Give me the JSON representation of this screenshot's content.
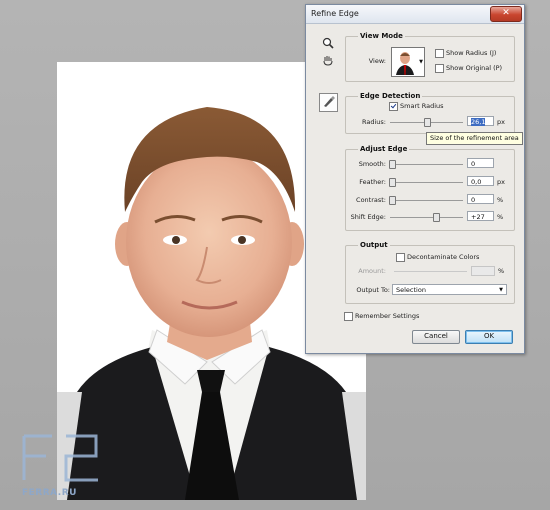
{
  "watermark": {
    "text": "FERRA.RU"
  },
  "dialog": {
    "title": "Refine Edge",
    "close_glyph": "✕",
    "view_mode": {
      "heading": "View Mode",
      "view_label": "View:",
      "show_radius": {
        "label": "Show Radius (J)",
        "checked": false
      },
      "show_original": {
        "label": "Show Original (P)",
        "checked": false
      }
    },
    "edge_detection": {
      "heading": "Edge Detection",
      "smart_radius": {
        "label": "Smart Radius",
        "checked": true
      },
      "radius": {
        "label": "Radius:",
        "value": "26,1",
        "unit": "px"
      }
    },
    "adjust_edge": {
      "heading": "Adjust Edge",
      "smooth": {
        "label": "Smooth:",
        "value": "0",
        "unit": ""
      },
      "feather": {
        "label": "Feather:",
        "value": "0,0",
        "unit": "px"
      },
      "contrast": {
        "label": "Contrast:",
        "value": "0",
        "unit": "%"
      },
      "shift_edge": {
        "label": "Shift Edge:",
        "value": "+27",
        "unit": "%"
      }
    },
    "output": {
      "heading": "Output",
      "decontaminate": {
        "label": "Decontaminate Colors",
        "checked": false
      },
      "amount": {
        "label": "Amount:",
        "value": "",
        "unit": "%"
      },
      "output_to": {
        "label": "Output To:",
        "value": "Selection"
      }
    },
    "remember": {
      "label": "Remember Settings",
      "checked": false
    },
    "buttons": {
      "cancel": "Cancel",
      "ok": "OK"
    },
    "tooltip": "Size of the refinement area"
  },
  "icons": {
    "zoom": "magnifier-icon",
    "hand": "hand-icon",
    "brush": "refine-radius-brush-icon"
  }
}
